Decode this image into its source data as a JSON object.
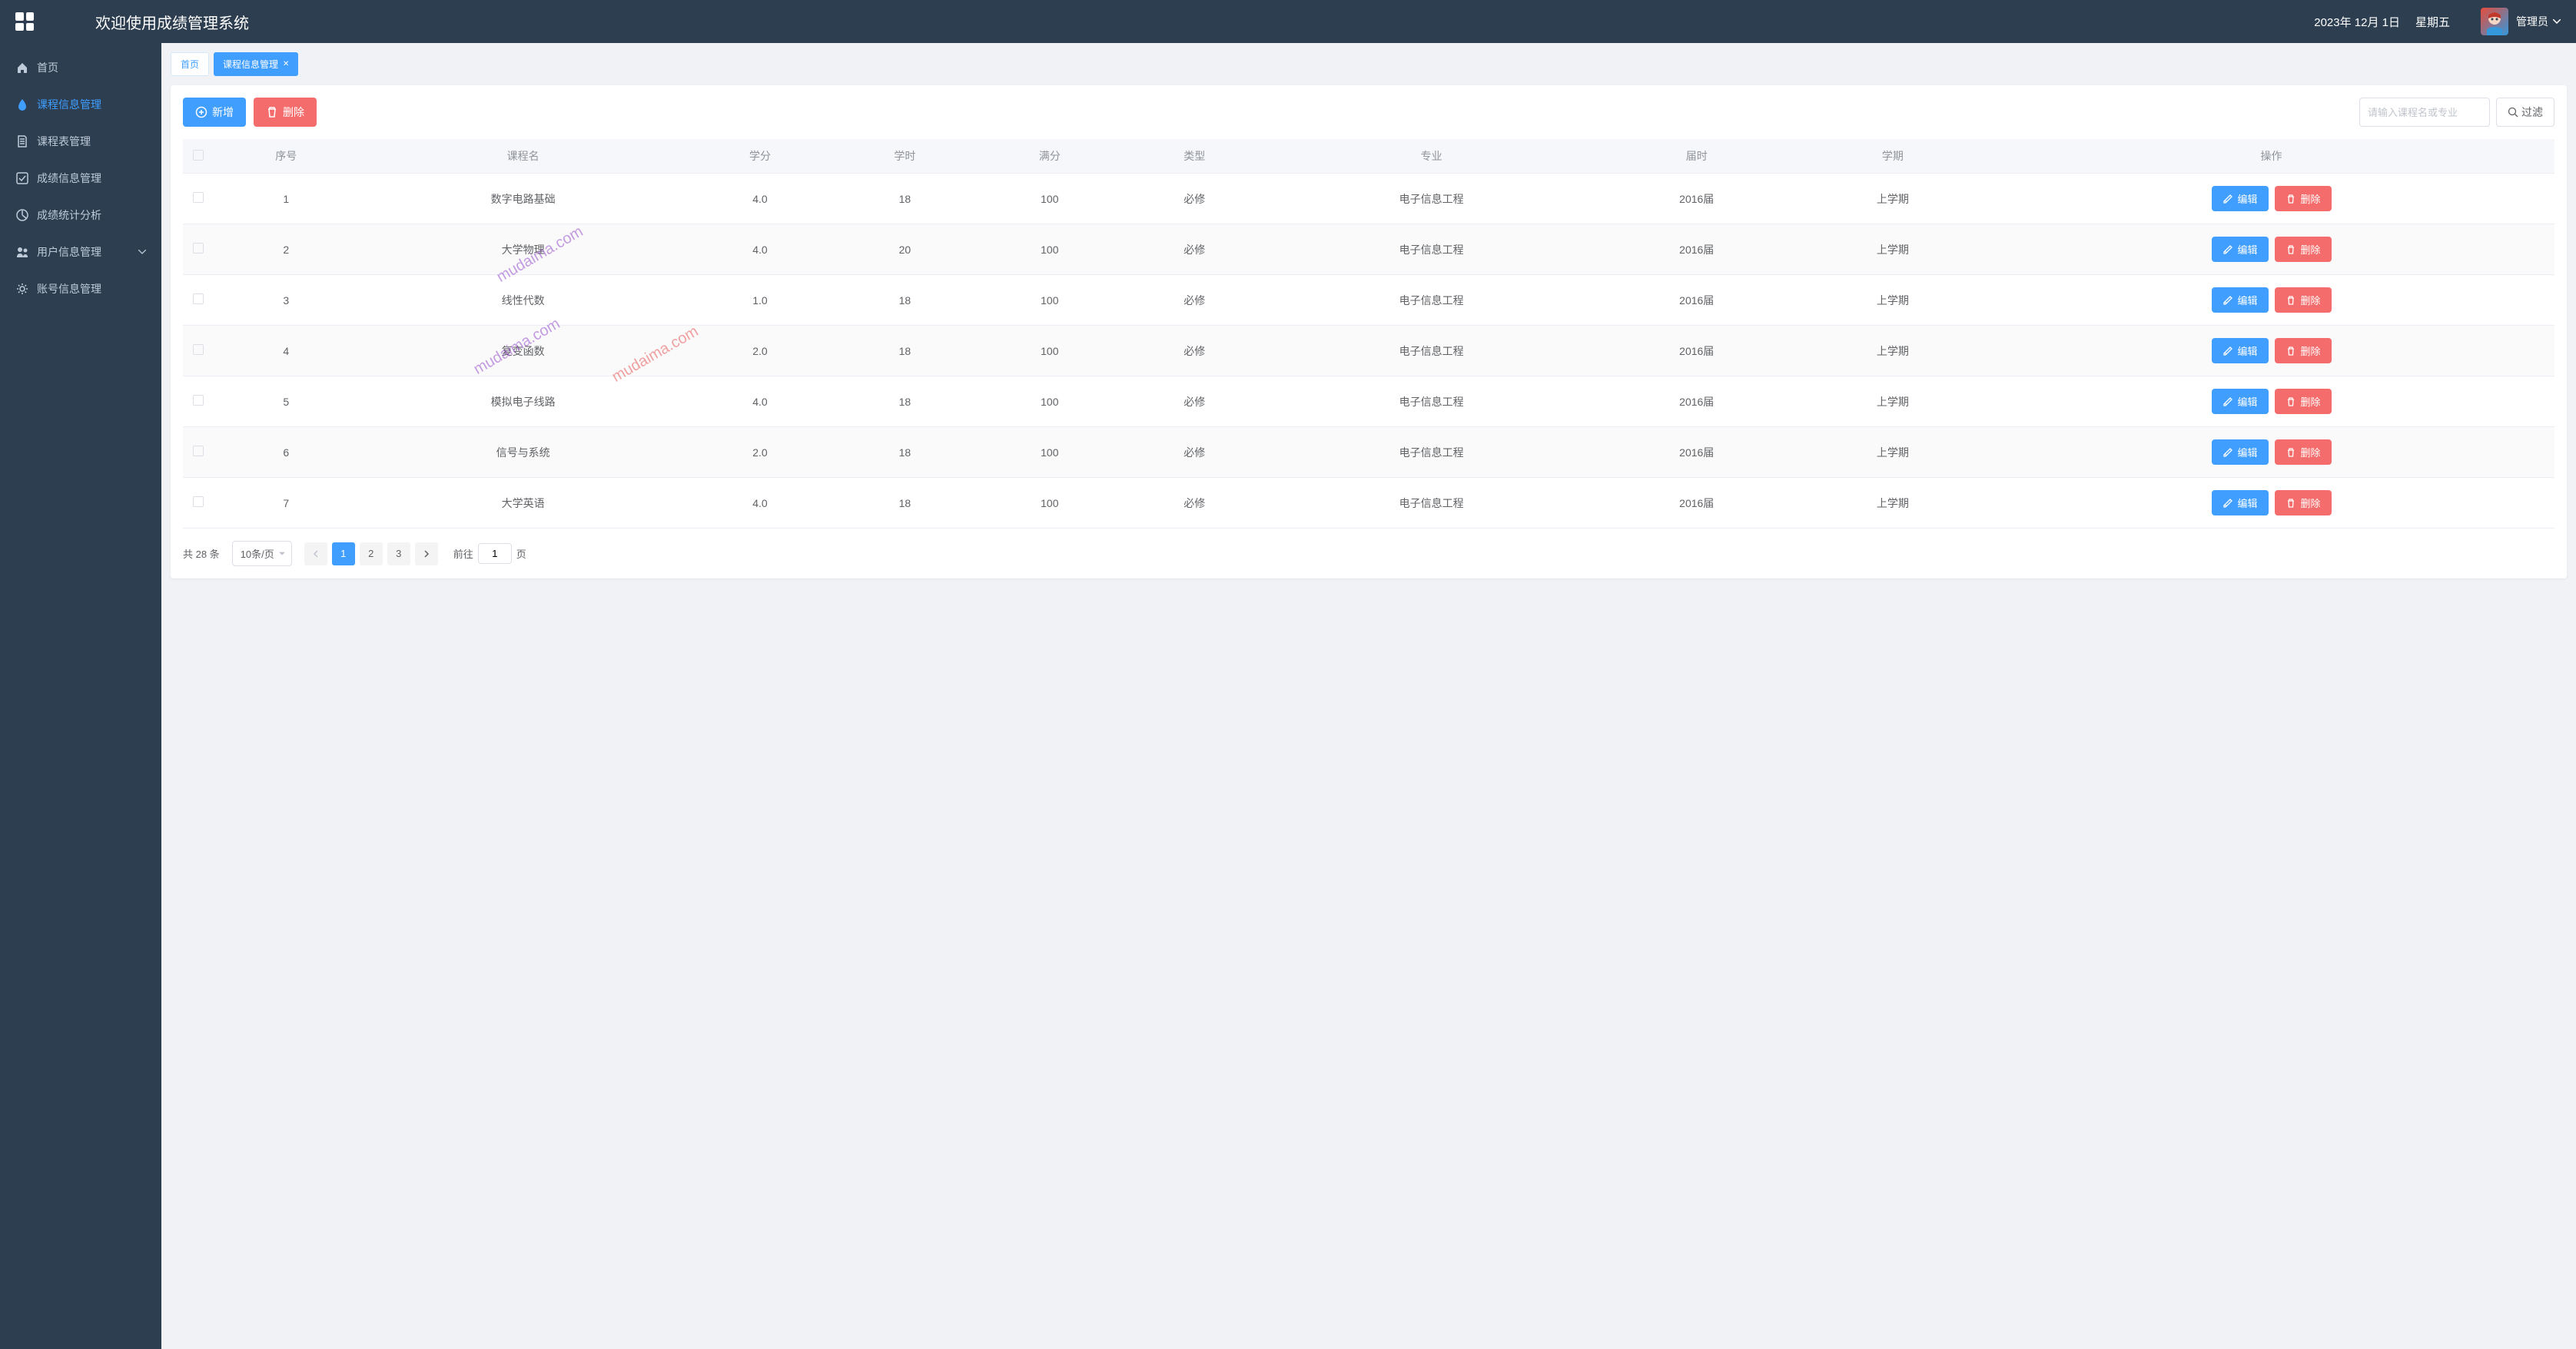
{
  "header": {
    "title": "欢迎使用成绩管理系统",
    "date": "2023年 12月 1日",
    "day": "星期五",
    "user": "管理员"
  },
  "sidebar": {
    "items": [
      {
        "label": "首页",
        "icon": "home"
      },
      {
        "label": "课程信息管理",
        "icon": "drop",
        "active": true
      },
      {
        "label": "课程表管理",
        "icon": "doc"
      },
      {
        "label": "成绩信息管理",
        "icon": "check"
      },
      {
        "label": "成绩统计分析",
        "icon": "chart"
      },
      {
        "label": "用户信息管理",
        "icon": "user",
        "expandable": true
      },
      {
        "label": "账号信息管理",
        "icon": "gear"
      }
    ]
  },
  "tabs": [
    {
      "label": "首页",
      "closable": false
    },
    {
      "label": "课程信息管理",
      "closable": true,
      "active": true
    }
  ],
  "toolbar": {
    "add_label": "新增",
    "delete_label": "删除",
    "search_placeholder": "请输入课程名或专业",
    "filter_label": "过滤"
  },
  "table": {
    "headers": [
      "",
      "序号",
      "课程名",
      "学分",
      "学时",
      "满分",
      "类型",
      "专业",
      "届时",
      "学期",
      "操作"
    ],
    "edit_label": "编辑",
    "delete_label": "删除",
    "rows": [
      {
        "no": "1",
        "name": "数字电路基础",
        "credit": "4.0",
        "hours": "18",
        "full": "100",
        "type": "必修",
        "major": "电子信息工程",
        "year": "2016届",
        "term": "上学期"
      },
      {
        "no": "2",
        "name": "大学物理",
        "credit": "4.0",
        "hours": "20",
        "full": "100",
        "type": "必修",
        "major": "电子信息工程",
        "year": "2016届",
        "term": "上学期"
      },
      {
        "no": "3",
        "name": "线性代数",
        "credit": "1.0",
        "hours": "18",
        "full": "100",
        "type": "必修",
        "major": "电子信息工程",
        "year": "2016届",
        "term": "上学期"
      },
      {
        "no": "4",
        "name": "复变函数",
        "credit": "2.0",
        "hours": "18",
        "full": "100",
        "type": "必修",
        "major": "电子信息工程",
        "year": "2016届",
        "term": "上学期"
      },
      {
        "no": "5",
        "name": "模拟电子线路",
        "credit": "4.0",
        "hours": "18",
        "full": "100",
        "type": "必修",
        "major": "电子信息工程",
        "year": "2016届",
        "term": "上学期"
      },
      {
        "no": "6",
        "name": "信号与系统",
        "credit": "2.0",
        "hours": "18",
        "full": "100",
        "type": "必修",
        "major": "电子信息工程",
        "year": "2016届",
        "term": "上学期"
      },
      {
        "no": "7",
        "name": "大学英语",
        "credit": "4.0",
        "hours": "18",
        "full": "100",
        "type": "必修",
        "major": "电子信息工程",
        "year": "2016届",
        "term": "上学期"
      }
    ]
  },
  "pagination": {
    "total_text": "共 28 条",
    "page_size": "10条/页",
    "pages": [
      "1",
      "2",
      "3"
    ],
    "current": 1,
    "jump_prefix": "前往",
    "jump_value": "1",
    "jump_suffix": "页"
  },
  "watermarks": [
    "mudaima.com",
    "mudaima.com",
    "mudaima.com"
  ]
}
